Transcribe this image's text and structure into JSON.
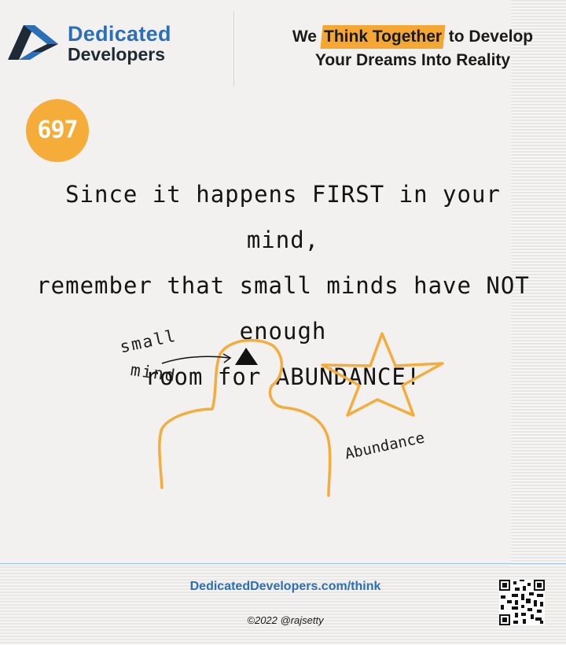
{
  "brand": {
    "line1": "Dedicated",
    "line2": "Developers",
    "logo_icon": "dd-chevron-logo",
    "colors": {
      "blue": "#2b6fb8",
      "dark": "#1e2a36"
    }
  },
  "tagline": {
    "pre": "We",
    "highlight": "Think Together",
    "post": "to Develop",
    "line2": "Your Dreams Into Reality",
    "highlight_color": "#f4a833"
  },
  "badge": {
    "number": "697",
    "color": "#f5ac38"
  },
  "quote": {
    "line1": "Since it happens FIRST in your mind,",
    "line2": "remember that small minds have NOT enough",
    "line3": "room for ABUNDANCE!"
  },
  "sketch": {
    "label_small": "small",
    "label_mind": "mind",
    "label_abundance": "Abundance",
    "stroke_color": "#f4ad3d"
  },
  "footer": {
    "url": "DedicatedDevelopers.com/think",
    "copyright": "©2022 @rajsetty",
    "qr_icon": "qr-code"
  }
}
